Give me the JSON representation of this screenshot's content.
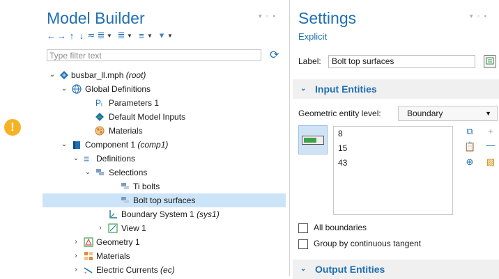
{
  "model_builder": {
    "title": "Model Builder",
    "filter_placeholder": "Type filter text",
    "tree": [
      {
        "label": "busbar_ll.mph",
        "suffix": "(root)",
        "icon": "model-icon"
      },
      {
        "label": "Global Definitions",
        "suffix": "",
        "icon": "globe-icon"
      },
      {
        "label": "Parameters 1",
        "suffix": "",
        "icon": "parameters-icon",
        "icon_text": "Pᵢ"
      },
      {
        "label": "Default Model Inputs",
        "suffix": "",
        "icon": "model-inputs-icon"
      },
      {
        "label": "Materials",
        "suffix": "",
        "icon": "materials-icon"
      },
      {
        "label": "Component 1",
        "suffix": "(comp1)",
        "icon": "component-icon"
      },
      {
        "label": "Definitions",
        "suffix": "",
        "icon": "definitions-icon"
      },
      {
        "label": "Selections",
        "suffix": "",
        "icon": "selections-icon"
      },
      {
        "label": "Ti bolts",
        "suffix": "",
        "icon": "selection-icon"
      },
      {
        "label": "Bolt top surfaces",
        "suffix": "",
        "icon": "selection-icon"
      },
      {
        "label": "Boundary System 1",
        "suffix": "(sys1)",
        "icon": "coordinate-system-icon"
      },
      {
        "label": "View 1",
        "suffix": "",
        "icon": "view-icon"
      },
      {
        "label": "Geometry 1",
        "suffix": "",
        "icon": "geometry-icon"
      },
      {
        "label": "Materials",
        "suffix": "",
        "icon": "materials-icon"
      },
      {
        "label": "Electric Currents",
        "suffix": "(ec)",
        "icon": "electric-currents-icon"
      }
    ]
  },
  "settings": {
    "title": "Settings",
    "subtitle": "Explicit",
    "label_caption": "Label:",
    "label_value": "Bolt top surfaces",
    "input_entities_header": "Input Entities",
    "geometric_level_caption": "Geometric entity level:",
    "geometric_level_value": "Boundary",
    "entities": [
      "8",
      "15",
      "43"
    ],
    "all_boundaries_label": "All boundaries",
    "group_tangent_label": "Group by continuous tangent",
    "output_entities_header": "Output Entities"
  },
  "colors": {
    "accent": "#1f6fb2",
    "selection": "#cce4f7",
    "warning": "#f5b324"
  }
}
